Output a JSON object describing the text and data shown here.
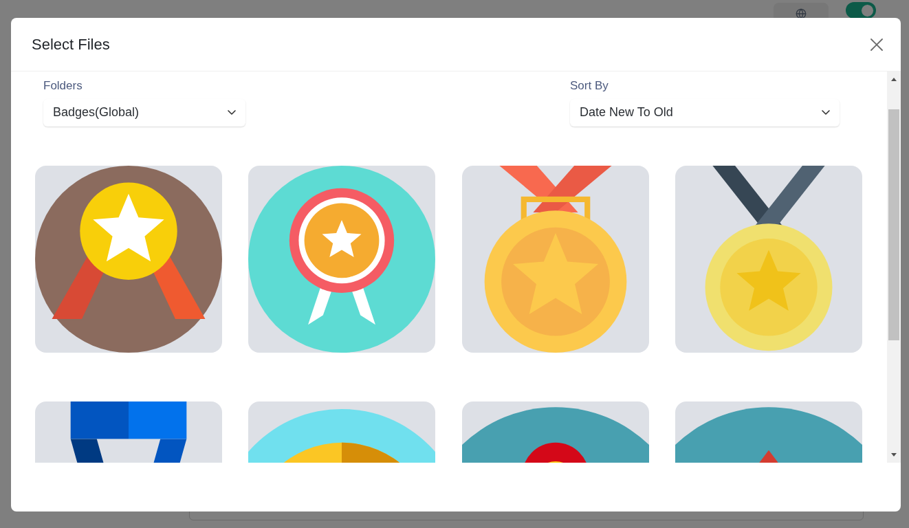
{
  "background": {
    "toggle": {
      "on": true
    }
  },
  "dialog": {
    "title": "Select Files",
    "filters": [
      {
        "label": "Folders",
        "value": "Badges(Global)"
      },
      {
        "label": "Sort By",
        "value": "Date New To Old"
      }
    ]
  }
}
